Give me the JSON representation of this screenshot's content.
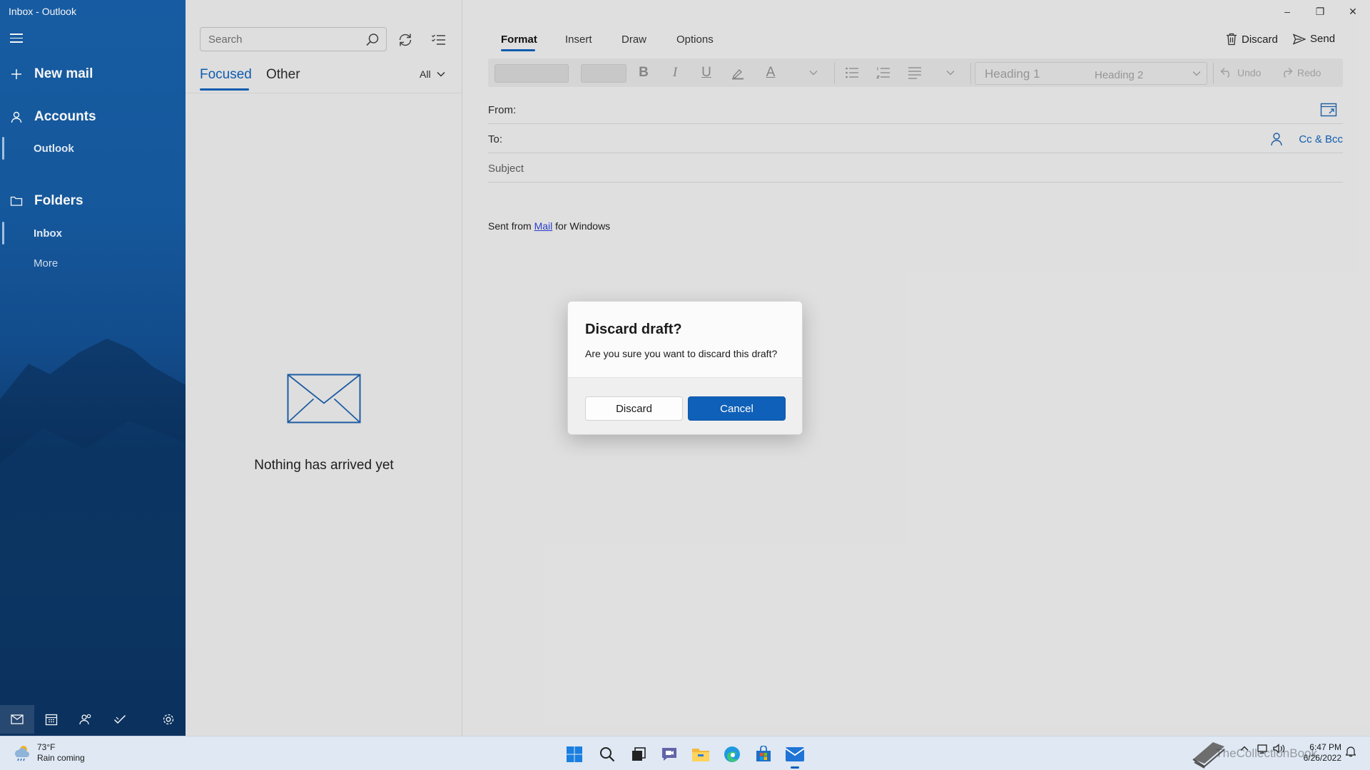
{
  "window": {
    "title": "Inbox - Outlook",
    "controls": {
      "minimize": "–",
      "restore": "❐",
      "close": "✕"
    }
  },
  "sidebar": {
    "new_mail": "New mail",
    "accounts_header": "Accounts",
    "account": "Outlook",
    "folders_header": "Folders",
    "inbox": "Inbox",
    "more": "More"
  },
  "list": {
    "search_placeholder": "Search",
    "tabs": {
      "focused": "Focused",
      "other": "Other"
    },
    "filter": "All",
    "empty_message": "Nothing has arrived yet"
  },
  "compose": {
    "ribbon_tabs": [
      "Format",
      "Insert",
      "Draw",
      "Options"
    ],
    "discard_label": "Discard",
    "send_label": "Send",
    "toolbar": {
      "bold": "B",
      "italic": "I",
      "underline": "U",
      "font_color": "A",
      "heading1": "Heading 1",
      "heading2": "Heading 2",
      "undo": "Undo",
      "redo": "Redo"
    },
    "from_label": "From:",
    "to_label": "To:",
    "cc_bcc": "Cc & Bcc",
    "subject_label": "Subject",
    "signature": {
      "prefix": "Sent from ",
      "link": "Mail",
      "suffix": " for Windows"
    }
  },
  "dialog": {
    "title": "Discard draft?",
    "message": "Are you sure you want to discard this draft?",
    "discard_button": "Discard",
    "cancel_button": "Cancel"
  },
  "taskbar": {
    "weather_temp": "73°F",
    "weather_desc": "Rain coming",
    "time": "6:47 PM",
    "date": "6/26/2022",
    "watermark": "TheCollectionBook"
  },
  "colors": {
    "sidebar": "#165aa0",
    "accent": "#0f60b8",
    "link": "#2a3fd0"
  }
}
